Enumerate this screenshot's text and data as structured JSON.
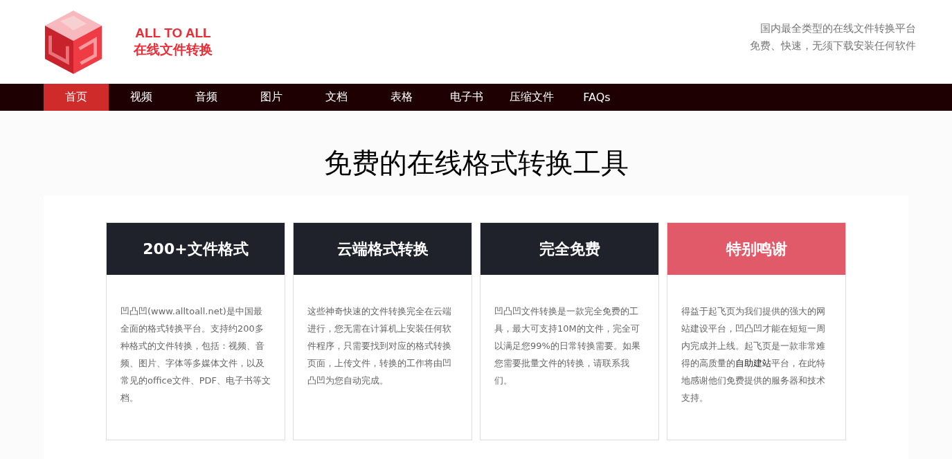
{
  "brand": {
    "name": "ALL TO ALL",
    "subtitle": "在线文件转换"
  },
  "slogan": [
    "国内最全类型的在线文件转换平台",
    "免费、快速，无须下载安装任何软件"
  ],
  "nav": [
    {
      "label": "首页",
      "selected": true
    },
    {
      "label": "视频",
      "selected": false
    },
    {
      "label": "音频",
      "selected": false
    },
    {
      "label": "图片",
      "selected": false
    },
    {
      "label": "文档",
      "selected": false
    },
    {
      "label": "表格",
      "selected": false
    },
    {
      "label": "电子书",
      "selected": false
    },
    {
      "label": "压缩文件",
      "selected": false
    },
    {
      "label": "FAQs",
      "selected": false
    }
  ],
  "heading": "免费的在线格式转换工具",
  "cards": [
    {
      "title": "200+文件格式",
      "color": "#20222b",
      "text": "凹凸凹(www.alltoall.net)是中国最全面的格式转换平台。支持约200多种格式的文件转换，包括：视频、音频、图片、字体等多媒体文件，以及常见的office文件、PDF、电子书等文档。"
    },
    {
      "title": "云端格式转换",
      "color": "#20222b",
      "text": "这些神奇快速的文件转换完全在云端进行，您无需在计算机上安装任何软件程序，只需要找到对应的格式转换页面，上传文件，转换的工作将由凹凸凹为您自动完成。"
    },
    {
      "title": "完全免费",
      "color": "#20222b",
      "text": "凹凸凹文件转换是一款完全免费的工具，最大可支持10M的文件，完全可以满足您99%的日常转换需要。如果您需要批量文件的转换，请联系我们。"
    },
    {
      "title": "特别鸣谢",
      "color": "#e05a6a",
      "text": "得益于起飞页为我们提供的强大的网站建设平台，凹凸凹才能在短短一周内完成并上线。起飞页是一款非常难得的高质量的",
      "link": "自助建站",
      "text_after": "平台，在此特地感谢他们免费提供的服务器和技术支持。"
    }
  ]
}
